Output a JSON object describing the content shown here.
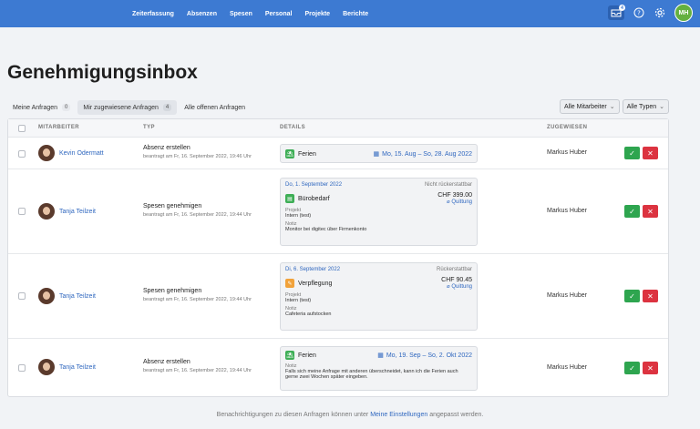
{
  "nav": [
    "Zeiterfassung",
    "Absenzen",
    "Spesen",
    "Personal",
    "Projekte",
    "Berichte"
  ],
  "topbar": {
    "inbox_count": "4",
    "user_initials": "MH"
  },
  "page_title": "Genehmigungsinbox",
  "tabs": [
    {
      "label": "Meine Anfragen",
      "count": "0"
    },
    {
      "label": "Mir zugewiesene Anfragen",
      "count": "4"
    },
    {
      "label": "Alle offenen Anfragen"
    }
  ],
  "filters": {
    "employees": "Alle Mitarbeiter",
    "types": "Alle Typen"
  },
  "columns": {
    "employee": "MITARBEITER",
    "type": "TYP",
    "details": "DETAILS",
    "assigned": "ZUGEWIESEN"
  },
  "rows": [
    {
      "employee": "Kevin Odermatt",
      "type": "Absenz erstellen",
      "requested": "beantragt am Fr, 16. September 2022, 19:46 Uhr",
      "detail_title": "Ferien",
      "detail_range": "Mo, 15. Aug – So, 28. Aug 2022",
      "assigned": "Markus Huber"
    },
    {
      "employee": "Tanja Teilzeit",
      "type": "Spesen genehmigen",
      "requested": "beantragt am Fr, 16. September 2022, 19:44 Uhr",
      "detail_date": "Do, 1. September 2022",
      "detail_status": "Nicht rückerstattbar",
      "detail_title": "Bürobedarf",
      "detail_amount": "CHF 399.00",
      "detail_receipt": "Quittung",
      "project_label": "Projekt",
      "project_value": "Intern (test)",
      "note_label": "Notiz",
      "note_value": "Monitor bei digitec über Firmenkonto",
      "assigned": "Markus Huber"
    },
    {
      "employee": "Tanja Teilzeit",
      "type": "Spesen genehmigen",
      "requested": "beantragt am Fr, 16. September 2022, 19:44 Uhr",
      "detail_date": "Di, 6. September 2022",
      "detail_status": "Rückerstattbar",
      "detail_title": "Verpflegung",
      "detail_amount": "CHF 90.45",
      "detail_receipt": "Quittung",
      "project_label": "Projekt",
      "project_value": "Intern (test)",
      "note_label": "Notiz",
      "note_value": "Cafeteria aufstocken",
      "assigned": "Markus Huber"
    },
    {
      "employee": "Tanja Teilzeit",
      "type": "Absenz erstellen",
      "requested": "beantragt am Fr, 16. September 2022, 19:44 Uhr",
      "detail_title": "Ferien",
      "detail_range": "Mo, 19. Sep – So, 2. Okt 2022",
      "note_label": "Notiz",
      "note_value": "Falls sich meine Anfrage mit anderen überschneidet, kann ich die Ferien auch gerne zwei Wochen später eingeben.",
      "assigned": "Markus Huber"
    }
  ],
  "footer": {
    "before": "Benachrichtigungen zu diesen Anfragen können unter",
    "link": "Meine Einstellungen",
    "after": "angepasst werden."
  },
  "colors": {
    "primary": "#3d7ad2",
    "approve": "#2ea54f",
    "reject": "#dc3340"
  }
}
